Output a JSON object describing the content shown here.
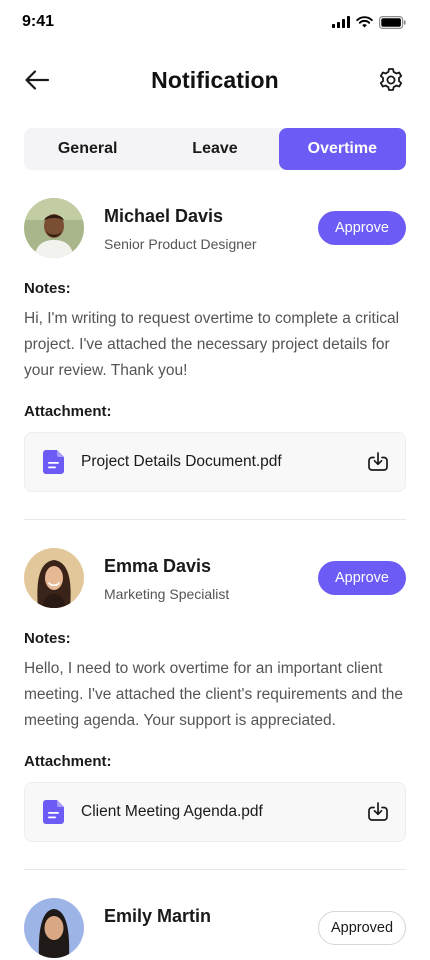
{
  "status": {
    "time": "9:41"
  },
  "header": {
    "title": "Notification"
  },
  "tabs": [
    {
      "label": "General",
      "active": false
    },
    {
      "label": "Leave",
      "active": false
    },
    {
      "label": "Overtime",
      "active": true
    }
  ],
  "requests": [
    {
      "name": "Michael Davis",
      "role": "Senior Product Designer",
      "action_label": "Approve",
      "notes_label": "Notes:",
      "notes": "Hi, I'm writing to request overtime to complete a critical project. I've attached the necessary project details for your review. Thank you!",
      "attachment_label": "Attachment:",
      "attachment": "Project Details Document.pdf"
    },
    {
      "name": "Emma Davis",
      "role": "Marketing Specialist",
      "action_label": "Approve",
      "notes_label": "Notes:",
      "notes": "Hello, I need to work overtime for an important client meeting. I've attached the client's requirements and the meeting agenda. Your support is appreciated.",
      "attachment_label": "Attachment:",
      "attachment": "Client Meeting Agenda.pdf"
    },
    {
      "name": "Emily Martin",
      "action_label": "Approved"
    }
  ],
  "colors": {
    "accent": "#6c5cf5",
    "tab_bg": "#f4f4f6",
    "card_bg": "#f8f8f9"
  }
}
